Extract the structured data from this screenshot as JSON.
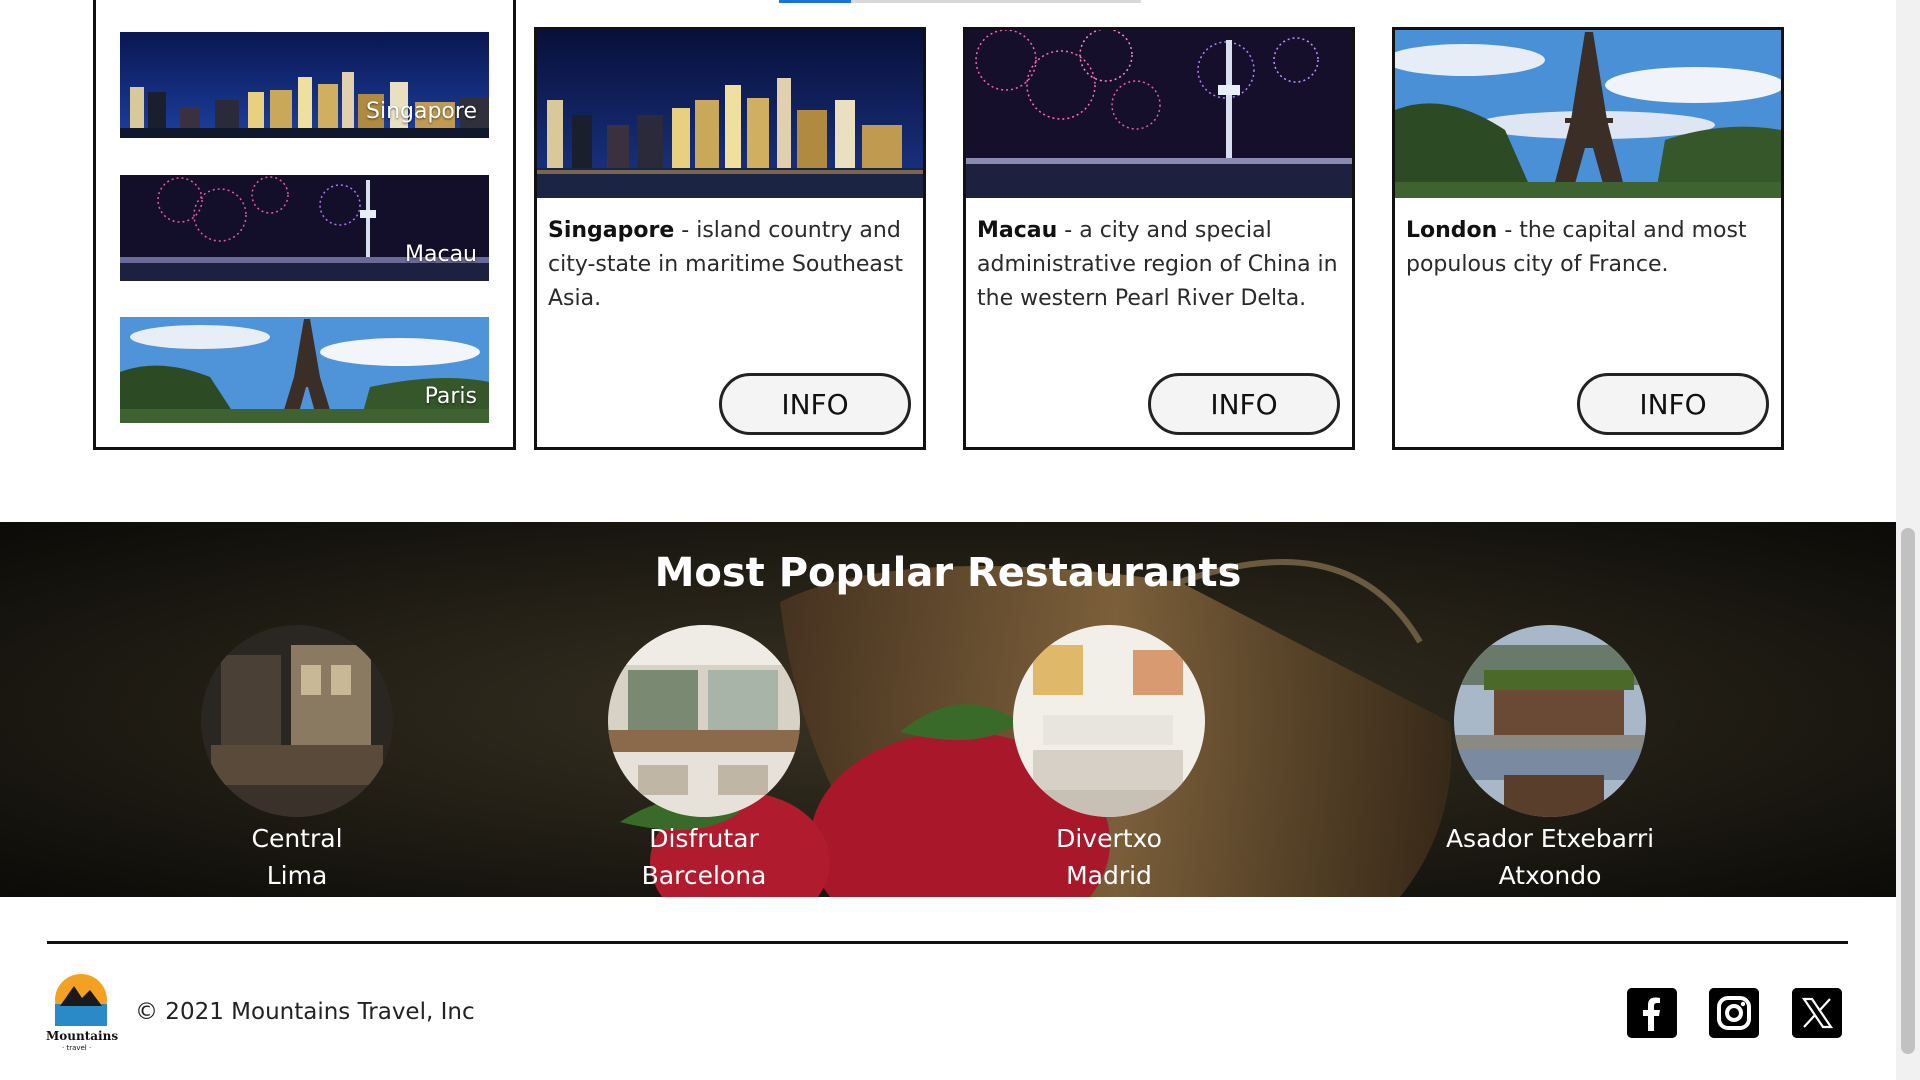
{
  "destinations": {
    "thumbnails": [
      {
        "label": "Singapore"
      },
      {
        "label": "Macau"
      },
      {
        "label": "Paris"
      }
    ],
    "cards": [
      {
        "name": "Singapore",
        "description": " - island country and city-state in maritime Southeast Asia.",
        "button": "INFO"
      },
      {
        "name": "Macau",
        "description": " - a city and special administrative region of China in the western Pearl River Delta.",
        "button": "INFO"
      },
      {
        "name": "London",
        "description": " - the capital and most populous city of France.",
        "button": "INFO"
      }
    ]
  },
  "restaurants": {
    "title": "Most Popular Restaurants",
    "items": [
      {
        "name": "Central",
        "city": "Lima"
      },
      {
        "name": "Disfrutar",
        "city": "Barcelona"
      },
      {
        "name": "Divertxo",
        "city": "Madrid"
      },
      {
        "name": "Asador Etxebarri",
        "city": "Atxondo"
      }
    ]
  },
  "footer": {
    "logo_text": "Mountains",
    "logo_sub": "· travel ·",
    "copyright": "© 2021 Mountains Travel, Inc",
    "social": [
      "facebook-icon",
      "instagram-icon",
      "x-icon"
    ]
  },
  "colors": {
    "border": "#111111",
    "button_bg": "#f4f4f4",
    "section_text": "#ffffff",
    "accent_tab": "#1a73d9"
  }
}
